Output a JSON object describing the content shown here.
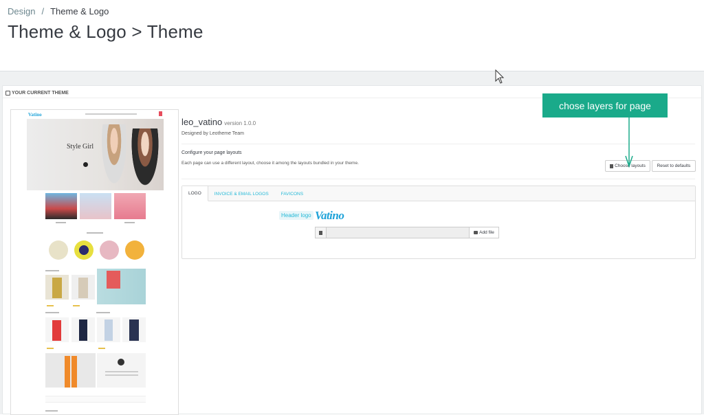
{
  "breadcrumb": {
    "parent": "Design",
    "separator": "/",
    "current": "Theme & Logo"
  },
  "page_title": "Theme & Logo > Theme",
  "panel": {
    "heading": "YOUR CURRENT THEME",
    "theme_name": "leo_vatino",
    "theme_version": "version 1.0.0",
    "designed_by": "Designed by Leotheme Team",
    "configure_title": "Configure your page layouts",
    "configure_desc": "Each page can use a different layout, choose it among the layouts bundled in your theme.",
    "choose_layouts_label": "Choose layouts",
    "reset_label": "Reset to defaults"
  },
  "preview": {
    "logo": "Vatino",
    "hero_title": "Style Girl"
  },
  "tabs": [
    {
      "label": "LOGO",
      "active": true
    },
    {
      "label": "INVOICE & EMAIL LOGOS",
      "active": false
    },
    {
      "label": "FAVICONS",
      "active": false
    }
  ],
  "logo_tab": {
    "header_logo_label": "Header logo",
    "logo_text": "Vatino",
    "add_file_label": "Add file"
  },
  "callout": {
    "text": "chose layers for page",
    "color": "#1aaa8a"
  },
  "colors": {
    "accent": "#25b9d7",
    "brand_logo": "#1fa3d9"
  }
}
